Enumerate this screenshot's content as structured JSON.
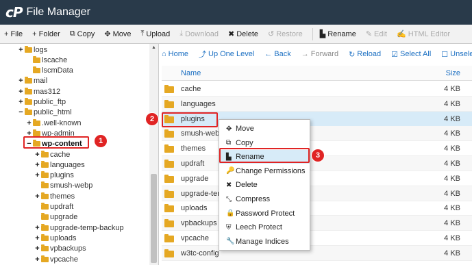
{
  "header": {
    "logo": "cP",
    "title": "File Manager"
  },
  "toolbar": [
    {
      "icon": "+",
      "icon_name": "plus-icon",
      "label": "File",
      "enabled": true
    },
    {
      "icon": "+",
      "icon_name": "plus-icon",
      "label": "Folder",
      "enabled": true
    },
    {
      "icon": "⧉",
      "icon_name": "copy-icon",
      "label": "Copy",
      "enabled": true
    },
    {
      "icon": "✥",
      "icon_name": "move-icon",
      "label": "Move",
      "enabled": true
    },
    {
      "icon": "⤒",
      "icon_name": "upload-icon",
      "label": "Upload",
      "enabled": true
    },
    {
      "icon": "⤓",
      "icon_name": "download-icon",
      "label": "Download",
      "enabled": false
    },
    {
      "icon": "✖",
      "icon_name": "delete-icon",
      "label": "Delete",
      "enabled": true
    },
    {
      "icon": "↺",
      "icon_name": "restore-icon",
      "label": "Restore",
      "enabled": false
    },
    {
      "icon": "▙",
      "icon_name": "rename-icon",
      "label": "Rename",
      "enabled": true
    },
    {
      "icon": "✎",
      "icon_name": "edit-icon",
      "label": "Edit",
      "enabled": false
    },
    {
      "icon": "✍",
      "icon_name": "html-editor-icon",
      "label": "HTML Editor",
      "enabled": false
    }
  ],
  "sidebar": {
    "items": [
      {
        "toggle": "+",
        "label": "logs"
      },
      {
        "toggle": "",
        "label": "lscache"
      },
      {
        "toggle": "",
        "label": "lscmData"
      },
      {
        "toggle": "+",
        "label": "mail"
      },
      {
        "toggle": "+",
        "label": "mas312"
      },
      {
        "toggle": "+",
        "label": "public_ftp"
      },
      {
        "toggle": "−",
        "label": "public_html"
      },
      {
        "toggle": "+",
        "label": ".well-known"
      },
      {
        "toggle": "+",
        "label": "wp-admin"
      },
      {
        "toggle": "−",
        "label": "wp-content"
      },
      {
        "toggle": "+",
        "label": "cache"
      },
      {
        "toggle": "+",
        "label": "languages"
      },
      {
        "toggle": "+",
        "label": "plugins"
      },
      {
        "toggle": "",
        "label": "smush-webp"
      },
      {
        "toggle": "+",
        "label": "themes"
      },
      {
        "toggle": "",
        "label": "updraft"
      },
      {
        "toggle": "",
        "label": "upgrade"
      },
      {
        "toggle": "+",
        "label": "upgrade-temp-backup"
      },
      {
        "toggle": "+",
        "label": "uploads"
      },
      {
        "toggle": "+",
        "label": "vpbackups"
      },
      {
        "toggle": "+",
        "label": "vpcache"
      }
    ]
  },
  "navbar": [
    {
      "icon": "⌂",
      "icon_name": "home-icon",
      "label": "Home",
      "enabled": true
    },
    {
      "icon": "⤴",
      "icon_name": "up-level-icon",
      "label": "Up One Level",
      "enabled": true
    },
    {
      "icon": "←",
      "icon_name": "back-icon",
      "label": "Back",
      "enabled": true
    },
    {
      "icon": "→",
      "icon_name": "forward-icon",
      "label": "Forward",
      "enabled": false
    },
    {
      "icon": "↻",
      "icon_name": "reload-icon",
      "label": "Reload",
      "enabled": true
    },
    {
      "icon": "☑",
      "icon_name": "select-all-icon",
      "label": "Select All",
      "enabled": true
    },
    {
      "icon": "☐",
      "icon_name": "unselect-icon",
      "label": "Unselect All",
      "enabled": true
    }
  ],
  "file_list": {
    "col_name": "Name",
    "col_size": "Size",
    "rows": [
      {
        "name": "cache",
        "size": "4 KB"
      },
      {
        "name": "languages",
        "size": "4 KB"
      },
      {
        "name": "plugins",
        "size": "4 KB"
      },
      {
        "name": "smush-webp",
        "size": "4 KB"
      },
      {
        "name": "themes",
        "size": "4 KB"
      },
      {
        "name": "updraft",
        "size": "4 KB"
      },
      {
        "name": "upgrade",
        "size": "4 KB"
      },
      {
        "name": "upgrade-temp-backup",
        "size": "4 KB"
      },
      {
        "name": "uploads",
        "size": "4 KB"
      },
      {
        "name": "vpbackups",
        "size": "4 KB"
      },
      {
        "name": "vpcache",
        "size": "4 KB"
      },
      {
        "name": "w3tc-config",
        "size": "4 KB"
      }
    ]
  },
  "context_menu": [
    {
      "icon": "✥",
      "icon_name": "move-icon",
      "label": "Move"
    },
    {
      "icon": "⧉",
      "icon_name": "copy-icon",
      "label": "Copy"
    },
    {
      "icon": "▙",
      "icon_name": "rename-icon",
      "label": "Rename"
    },
    {
      "icon": "🔑",
      "icon_name": "key-icon",
      "label": "Change Permissions"
    },
    {
      "icon": "✖",
      "icon_name": "delete-icon",
      "label": "Delete"
    },
    {
      "icon": "⤡",
      "icon_name": "compress-icon",
      "label": "Compress"
    },
    {
      "icon": "🔒",
      "icon_name": "lock-icon",
      "label": "Password Protect"
    },
    {
      "icon": "⛨",
      "icon_name": "shield-icon",
      "label": "Leech Protect"
    },
    {
      "icon": "🔧",
      "icon_name": "wrench-icon",
      "label": "Manage Indices"
    }
  ],
  "markers": [
    "1",
    "2",
    "3"
  ],
  "colors": {
    "header": "#293a4a",
    "link": "#1b6fc2",
    "folder": "#e5a823",
    "highlight": "#e02424",
    "selected_row": "#d7ebf8"
  }
}
